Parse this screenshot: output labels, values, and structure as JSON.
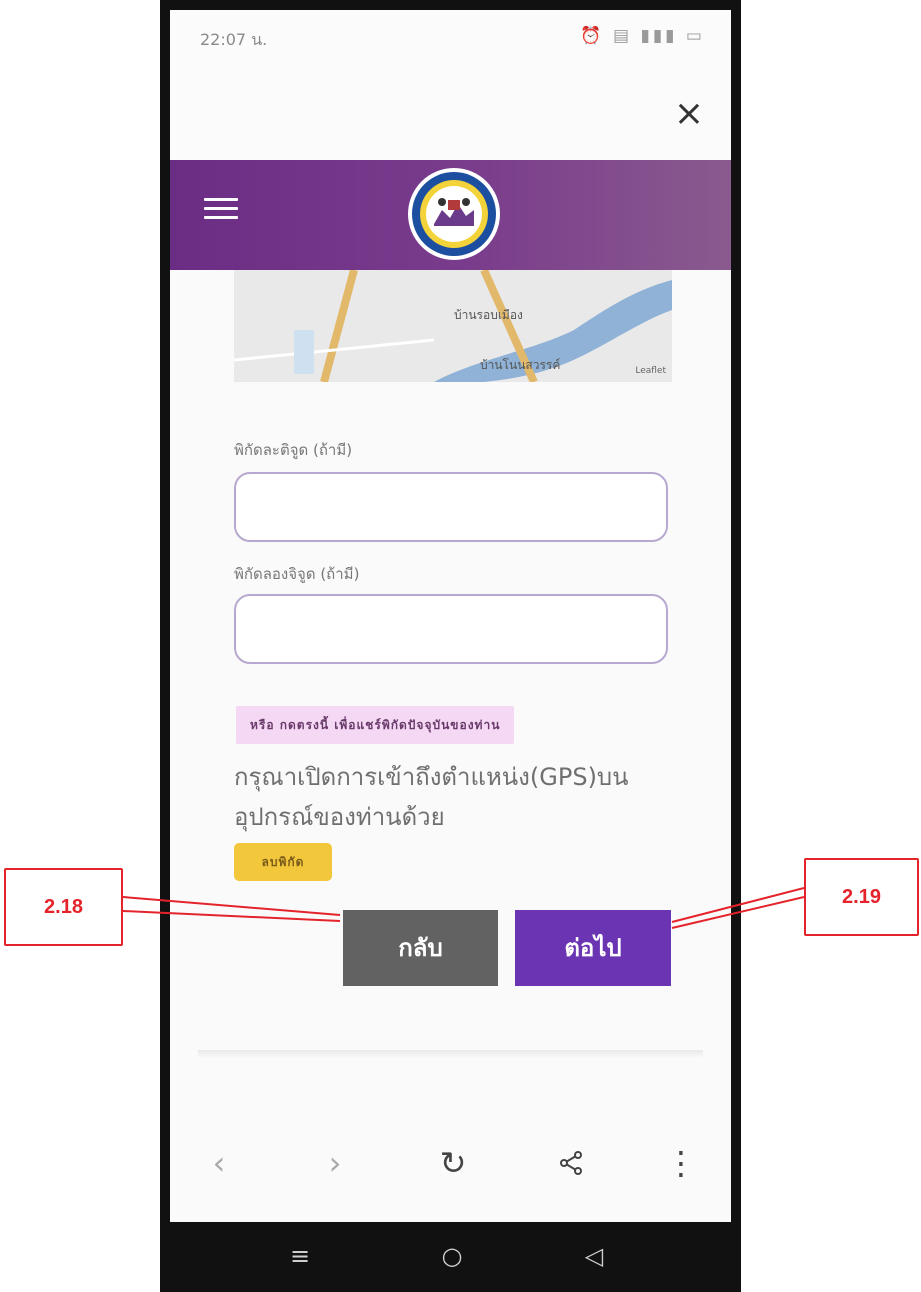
{
  "status_bar": {
    "time": "22:07 น.",
    "icons": "⏰ ▤ ▮▮▮ ▭"
  },
  "close_icon": "×",
  "header": {
    "menu_icon": "hamburger-icon",
    "logo_icon": "municipality-seal-icon"
  },
  "map": {
    "label_1": "บ้านรอบเมือง",
    "label_2": "บ้านโนนสวรรค์",
    "attribution": "Leaflet"
  },
  "form": {
    "latitude_label": "พิกัดละติจูด (ถ้ามี)",
    "latitude_value": "",
    "longitude_label": "พิกัดลองจิจูด (ถ้ามี)",
    "longitude_value": "",
    "share_location_link": "หรือ กดตรงนี้ เพื่อแชร์พิกัดปัจจุบันของท่าน",
    "gps_note": "กรุณาเปิดการเข้าถึงตำแหน่ง(GPS)บนอุปกรณ์ของท่านด้วย",
    "clear_button": "ลบพิกัด"
  },
  "buttons": {
    "back": "กลับ",
    "next": "ต่อไป"
  },
  "browser_nav": {
    "back_icon": "‹",
    "forward_icon": "›",
    "reload_icon": "↻",
    "share_icon": "share-icon",
    "menu_icon": "⋮"
  },
  "android_nav": {
    "menu": "≡",
    "home": "○",
    "back": "◁"
  },
  "annotations": {
    "left": "2.18",
    "right": "2.19"
  },
  "colors": {
    "header_purple": "#6a2d84",
    "next_purple": "#6b34b3",
    "back_gray": "#626262",
    "callout_red": "#e4232b",
    "clear_yellow": "#f2c73c"
  }
}
